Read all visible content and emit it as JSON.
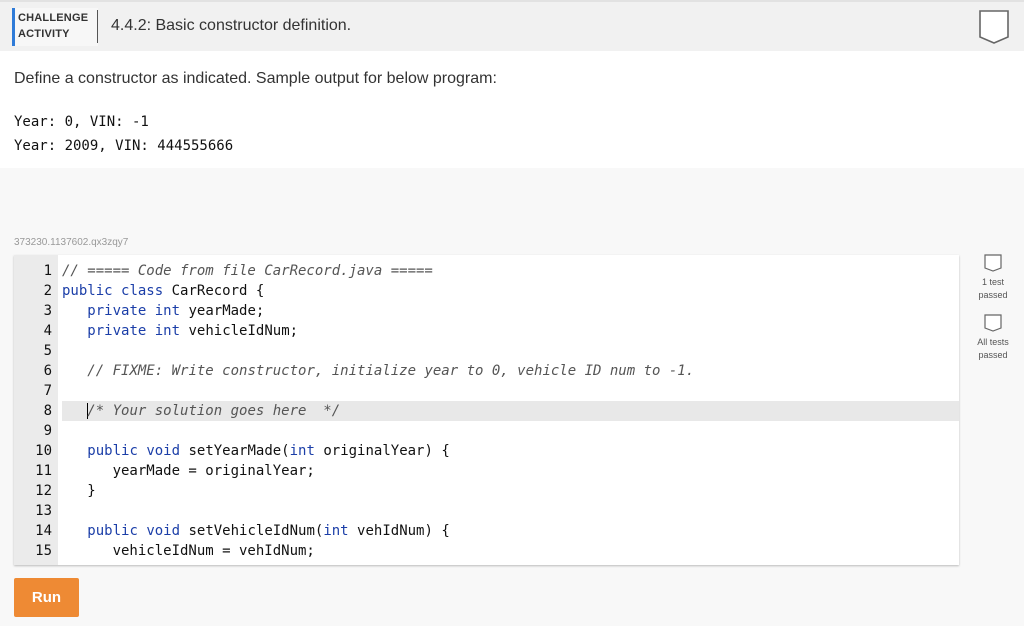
{
  "header": {
    "badge_line1": "CHALLENGE",
    "badge_line2": "ACTIVITY",
    "title": "4.4.2: Basic constructor definition."
  },
  "instructions": "Define a constructor as indicated. Sample output for below program:",
  "sample_output": [
    "Year: 0, VIN: -1",
    "Year: 2009, VIN: 444555666"
  ],
  "code_id": "373230.1137602.qx3zqy7",
  "editor": {
    "lines": [
      {
        "n": "1",
        "text": "// ===== Code from file CarRecord.java ====="
      },
      {
        "n": "2",
        "text": "public class CarRecord {"
      },
      {
        "n": "3",
        "text": "   private int yearMade;"
      },
      {
        "n": "4",
        "text": "   private int vehicleIdNum;"
      },
      {
        "n": "5",
        "text": ""
      },
      {
        "n": "6",
        "text": "   // FIXME: Write constructor, initialize year to 0, vehicle ID num to -1."
      },
      {
        "n": "7",
        "text": ""
      },
      {
        "n": "8",
        "text": "   /* Your solution goes here  */"
      },
      {
        "n": "9",
        "text": ""
      },
      {
        "n": "10",
        "text": "   public void setYearMade(int originalYear) {"
      },
      {
        "n": "11",
        "text": "      yearMade = originalYear;"
      },
      {
        "n": "12",
        "text": "   }"
      },
      {
        "n": "13",
        "text": ""
      },
      {
        "n": "14",
        "text": "   public void setVehicleIdNum(int vehIdNum) {"
      },
      {
        "n": "15",
        "text": "      vehicleIdNum = vehIdNum;"
      }
    ]
  },
  "tests": [
    {
      "label_line1": "1 test",
      "label_line2": "passed"
    },
    {
      "label_line1": "All tests",
      "label_line2": "passed"
    }
  ],
  "run_label": "Run",
  "colors": {
    "accent_blue": "#2f7bd8",
    "run_orange": "#ee8a34",
    "keyword": "#1b3ea8"
  }
}
